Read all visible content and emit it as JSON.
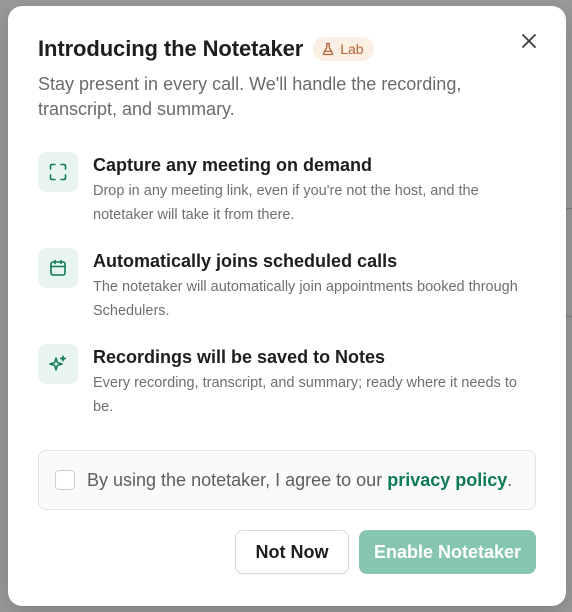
{
  "dialog": {
    "title": "Introducing the Notetaker",
    "badge": "Lab",
    "subtitle": "Stay present in every call. We'll handle the recording, transcript, and summary.",
    "close_icon": "close-icon"
  },
  "features": [
    {
      "icon": "capture-frame-icon",
      "title": "Capture any meeting on demand",
      "description": "Drop in any meeting link, even if you're not the host, and the notetaker will take it from there."
    },
    {
      "icon": "calendar-icon",
      "title": "Automatically joins scheduled calls",
      "description": "The notetaker will automatically join appointments booked through Schedulers."
    },
    {
      "icon": "sparkles-icon",
      "title": "Recordings will be saved to Notes",
      "description": "Every recording, transcript, and summary; ready where it needs to be."
    }
  ],
  "consent": {
    "text_prefix": "By using the notetaker, I agree to our ",
    "link_text": "privacy policy",
    "text_suffix": ".",
    "checked": false
  },
  "actions": {
    "secondary_label": "Not Now",
    "primary_label": "Enable Notetaker"
  },
  "colors": {
    "accent": "#0f7a55",
    "icon_bg": "#e7f4ef",
    "primary_button_disabled": "#87c6ae",
    "badge_bg": "#fbeee3",
    "badge_text": "#b7643b"
  }
}
